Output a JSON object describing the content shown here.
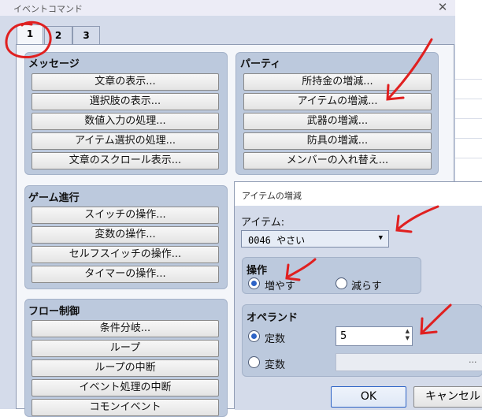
{
  "event_window": {
    "title": "イベントコマンド",
    "tabs": [
      "1",
      "2",
      "3"
    ],
    "message_group": {
      "title": "メッセージ",
      "buttons": [
        "文章の表示...",
        "選択肢の表示...",
        "数値入力の処理...",
        "アイテム選択の処理...",
        "文章のスクロール表示..."
      ]
    },
    "party_group": {
      "title": "パーティ",
      "buttons": [
        "所持金の増減...",
        "アイテムの増減...",
        "武器の増減...",
        "防具の増減...",
        "メンバーの入れ替え..."
      ]
    },
    "game_group": {
      "title": "ゲーム進行",
      "buttons": [
        "スイッチの操作...",
        "変数の操作...",
        "セルフスイッチの操作...",
        "タイマーの操作..."
      ]
    },
    "flow_group": {
      "title": "フロー制御",
      "buttons": [
        "条件分岐...",
        "ループ",
        "ループの中断",
        "イベント処理の中断",
        "コモンイベント"
      ]
    }
  },
  "dialog": {
    "title": "アイテムの増減",
    "item_label": "アイテム:",
    "item_value": "0046 やさい",
    "operation_title": "操作",
    "increase": "増やす",
    "decrease": "減らす",
    "operation_selected": "increase",
    "operand_title": "オペランド",
    "constant": "定数",
    "variable": "変数",
    "operand_selected": "constant",
    "constant_value": "5",
    "ellipsis": "...",
    "ok": "OK",
    "cancel": "キャンセル"
  },
  "colors": {
    "annotation": "#e02020",
    "panel": "#d4dbea",
    "group": "#bcc9dd"
  },
  "icons": {
    "close": "close-icon",
    "dropdown": "triangle-down-icon",
    "spinner": "spin-arrows-icon"
  }
}
